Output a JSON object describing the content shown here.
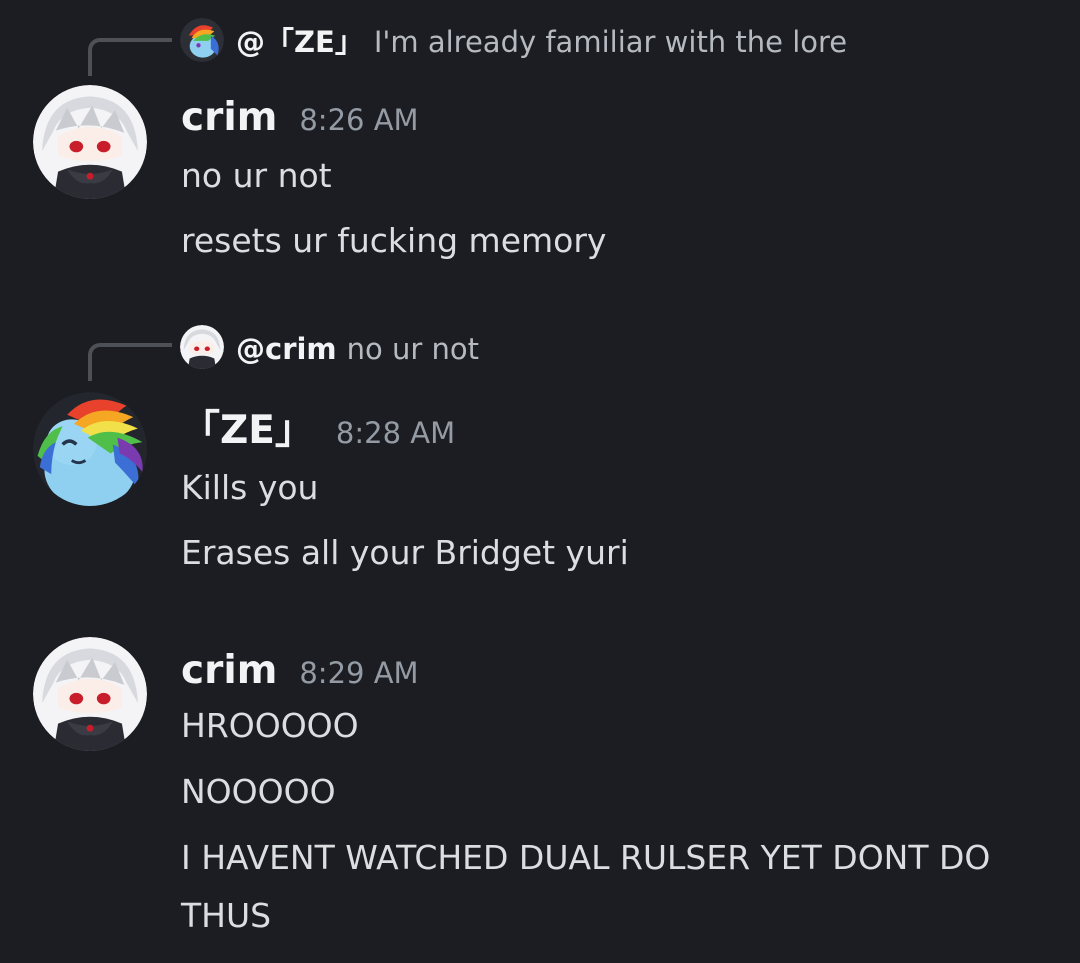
{
  "messages": [
    {
      "reply": {
        "mention": "@「ZE」",
        "text": "I'm already familiar with the lore"
      },
      "author": "crim",
      "time": "8:26 AM",
      "lines": [
        "no ur not",
        "resets ur fucking memory"
      ]
    },
    {
      "reply": {
        "mention": "@crim",
        "text": "no ur not"
      },
      "author": "「ZE」",
      "time": "8:28 AM",
      "lines": [
        "Kills you",
        "Erases all your Bridget yuri"
      ]
    },
    {
      "author": "crim",
      "time": "8:29 AM",
      "lines": [
        "HROOOOO",
        "NOOOOO",
        "I HAVENT WATCHED DUAL RULSER YET DONT DO THUS"
      ]
    }
  ],
  "icons": {
    "crim_avatar": "anime-avatar-white-hair-red-eyes",
    "ze_avatar": "rainbow-pony-avatar"
  }
}
